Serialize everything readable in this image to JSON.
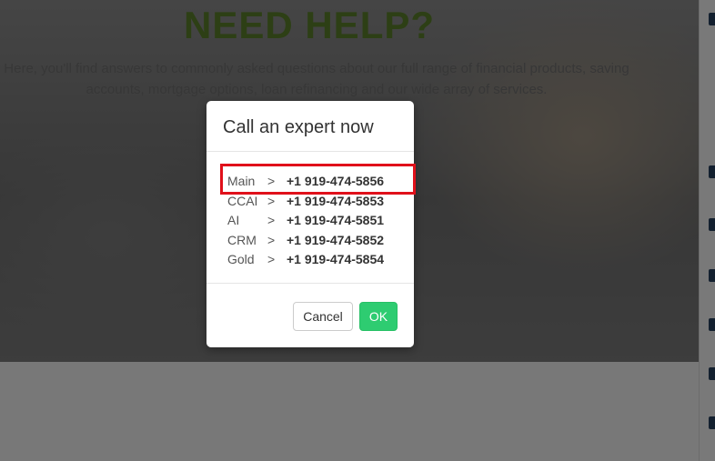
{
  "hero": {
    "title": "NEED HELP?",
    "text": "Here, you'll find answers to commonly asked questions about our full range of financial products, saving accounts, mortgage options, loan refinancing and our wide array of services."
  },
  "modal": {
    "title": "Call an expert now",
    "phones": [
      {
        "label": "Main",
        "sep": ">",
        "number": "+1 919-474-5856"
      },
      {
        "label": "CCAI",
        "sep": ">",
        "number": "+1 919-474-5853"
      },
      {
        "label": "AI",
        "sep": ">",
        "number": "+1 919-474-5851"
      },
      {
        "label": "CRM",
        "sep": ">",
        "number": "+1 919-474-5852"
      },
      {
        "label": "Gold",
        "sep": ">",
        "number": "+1 919-474-5854"
      }
    ],
    "cancel_label": "Cancel",
    "ok_label": "OK"
  },
  "colors": {
    "ok_button": "#2ecc71",
    "highlight_box": "#e0101a",
    "hero_title": "#5a7f2a"
  }
}
